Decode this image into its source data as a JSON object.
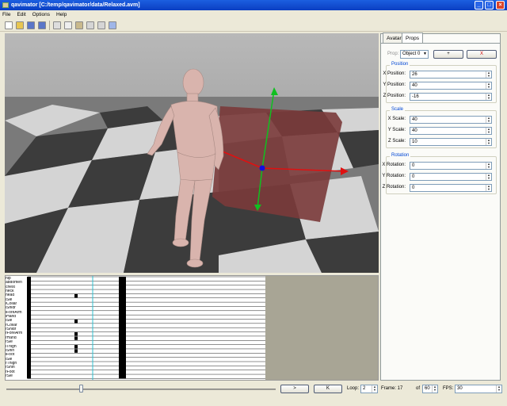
{
  "window": {
    "title": "qavimator [C:/temp/qavimator/data/Relaxed.avm]",
    "controls": [
      "_",
      "□",
      "×"
    ]
  },
  "menu": [
    "File",
    "Edit",
    "Options",
    "Help"
  ],
  "toolbar_icons": [
    "new-file-icon",
    "open-folder-icon",
    "save-icon",
    "save-as-icon",
    "cut-icon",
    "copy-icon",
    "paste-icon",
    "undo-icon",
    "redo-icon",
    "figure-icon"
  ],
  "timeline": {
    "bones": [
      "hip",
      "abdomen",
      "chest",
      "neck",
      "head",
      "lSle",
      "lCollar",
      "lShldr",
      "lForeArm",
      "lHand",
      "lSle",
      "rCollar",
      "rShldr",
      "rForeArm",
      "rHand",
      "rSle",
      "lThigh",
      "lShin",
      "lFoot",
      "lSle",
      "rThigh",
      "rShin",
      "rFoot",
      "rSle"
    ],
    "keyframes": [
      [
        4,
        1
      ],
      [
        10,
        1
      ],
      [
        13,
        1
      ],
      [
        14,
        1
      ],
      [
        16,
        1
      ],
      [
        17,
        1
      ]
    ]
  },
  "panel": {
    "tabs": [
      "Avatar",
      "Props"
    ],
    "prop_label": "Prop:",
    "prop_select": "Object 0",
    "add_label": "+",
    "delete_label": "X",
    "position": {
      "title": "Position",
      "x_label": "X Position:",
      "x": "26",
      "y_label": "Y Position:",
      "y": "40",
      "z_label": "Z Position:",
      "z": "-16"
    },
    "scale": {
      "title": "Scale",
      "x_label": "X Scale:",
      "x": "40",
      "y_label": "Y Scale:",
      "y": "40",
      "z_label": "Z Scale:",
      "z": "10"
    },
    "rotation": {
      "title": "Rotation",
      "x_label": "X Rotation:",
      "x": "0",
      "y_label": "Y Rotation:",
      "y": "0",
      "z_label": "Z Rotation:",
      "z": "0"
    }
  },
  "bottom": {
    "play_label": ">",
    "key_label": "K",
    "loop_label": "Loop:",
    "loop_value": "2",
    "frame_label": "Frame: 17",
    "of_label": "of",
    "of_value": "60",
    "fps_label": "FPS:",
    "fps_value": "30",
    "slider_fraction": 0.27
  },
  "colors": {
    "titlebar": "#0a3ec2",
    "prop_box": "#7a3a3a",
    "figure": "#d9b4ad",
    "axis_red": "#e01010",
    "axis_green": "#10c020",
    "axis_blue": "#1010e0",
    "timeline_cursor": "#30c0d0"
  }
}
